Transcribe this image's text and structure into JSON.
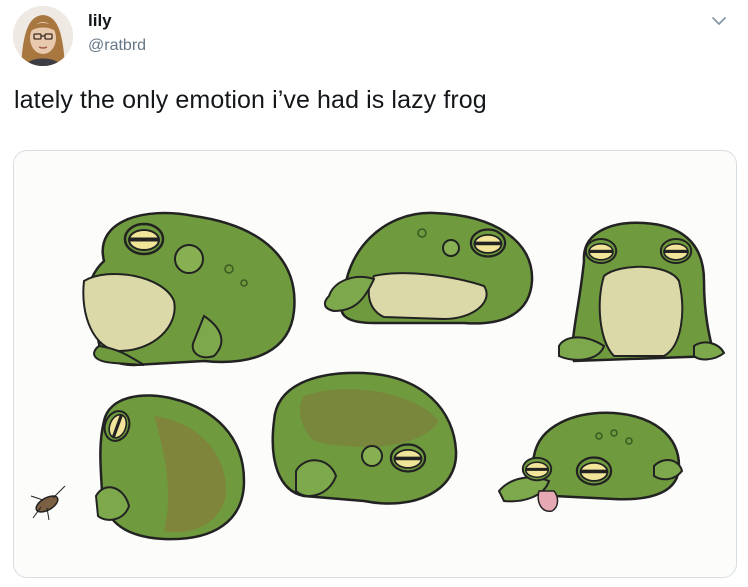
{
  "tweet": {
    "author_name": "lily",
    "author_handle": "@ratbrd",
    "text": "lately the only emotion i’ve had is lazy frog"
  },
  "icons": {
    "menu": "chevron-down-icon",
    "avatar": "avatar"
  },
  "colors": {
    "handle_gray": "#657786",
    "frog_green": "#6f9a3e",
    "frog_belly": "#dcd9a8",
    "card_border": "#d7dee3"
  }
}
